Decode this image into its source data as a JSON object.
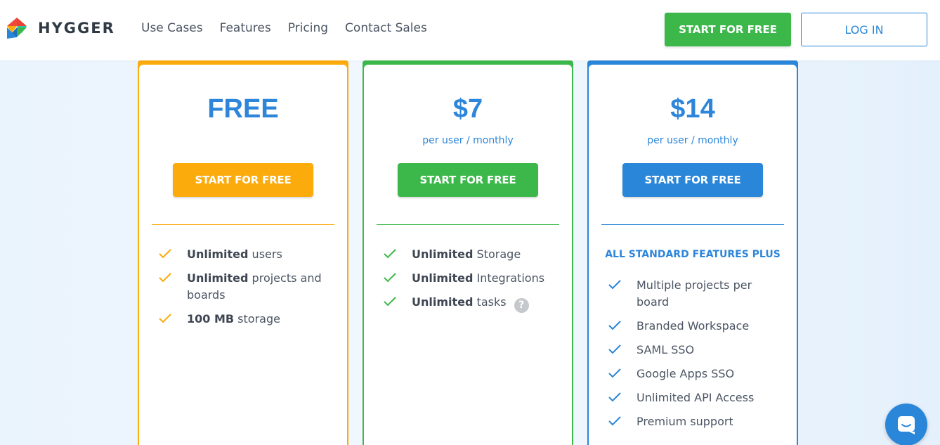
{
  "brand": {
    "name": "HYGGER"
  },
  "nav": {
    "items": [
      "Use Cases",
      "Features",
      "Pricing",
      "Contact Sales"
    ],
    "start_label": "START FOR FREE",
    "login_label": "LOG IN"
  },
  "plans": [
    {
      "price": "FREE",
      "per": "",
      "button": "START FOR FREE",
      "accent": "#fbab0c",
      "features": [
        {
          "bold": "Unlimited",
          "text": " users"
        },
        {
          "bold": "Unlimited",
          "text": " projects and boards"
        },
        {
          "bold": "100 MB",
          "text": " storage"
        }
      ]
    },
    {
      "price": "$7",
      "per": "per user / monthly",
      "button": "START FOR FREE",
      "accent": "#3cb84a",
      "features": [
        {
          "bold": "Unlimited",
          "text": " Storage"
        },
        {
          "bold": "Unlimited",
          "text": " Integrations"
        },
        {
          "bold": "Unlimited",
          "text": " tasks",
          "help": "?"
        }
      ]
    },
    {
      "price": "$14",
      "per": "per user / monthly",
      "button": "START FOR FREE",
      "accent": "#2a86d8",
      "subheading": "ALL STANDARD FEATURES PLUS",
      "features": [
        {
          "text": "Multiple projects per board"
        },
        {
          "text": "Branded Workspace"
        },
        {
          "text": "SAML SSO"
        },
        {
          "text": "Google Apps SSO"
        },
        {
          "text": "Unlimited API Access"
        },
        {
          "text": "Premium support"
        }
      ]
    }
  ],
  "colors": {
    "orange": "#fbab0c",
    "green": "#3cb84a",
    "blue": "#2a86d8"
  },
  "icons": {
    "chat": "chat-bubble-icon",
    "logo": "hygger-logo-icon"
  }
}
